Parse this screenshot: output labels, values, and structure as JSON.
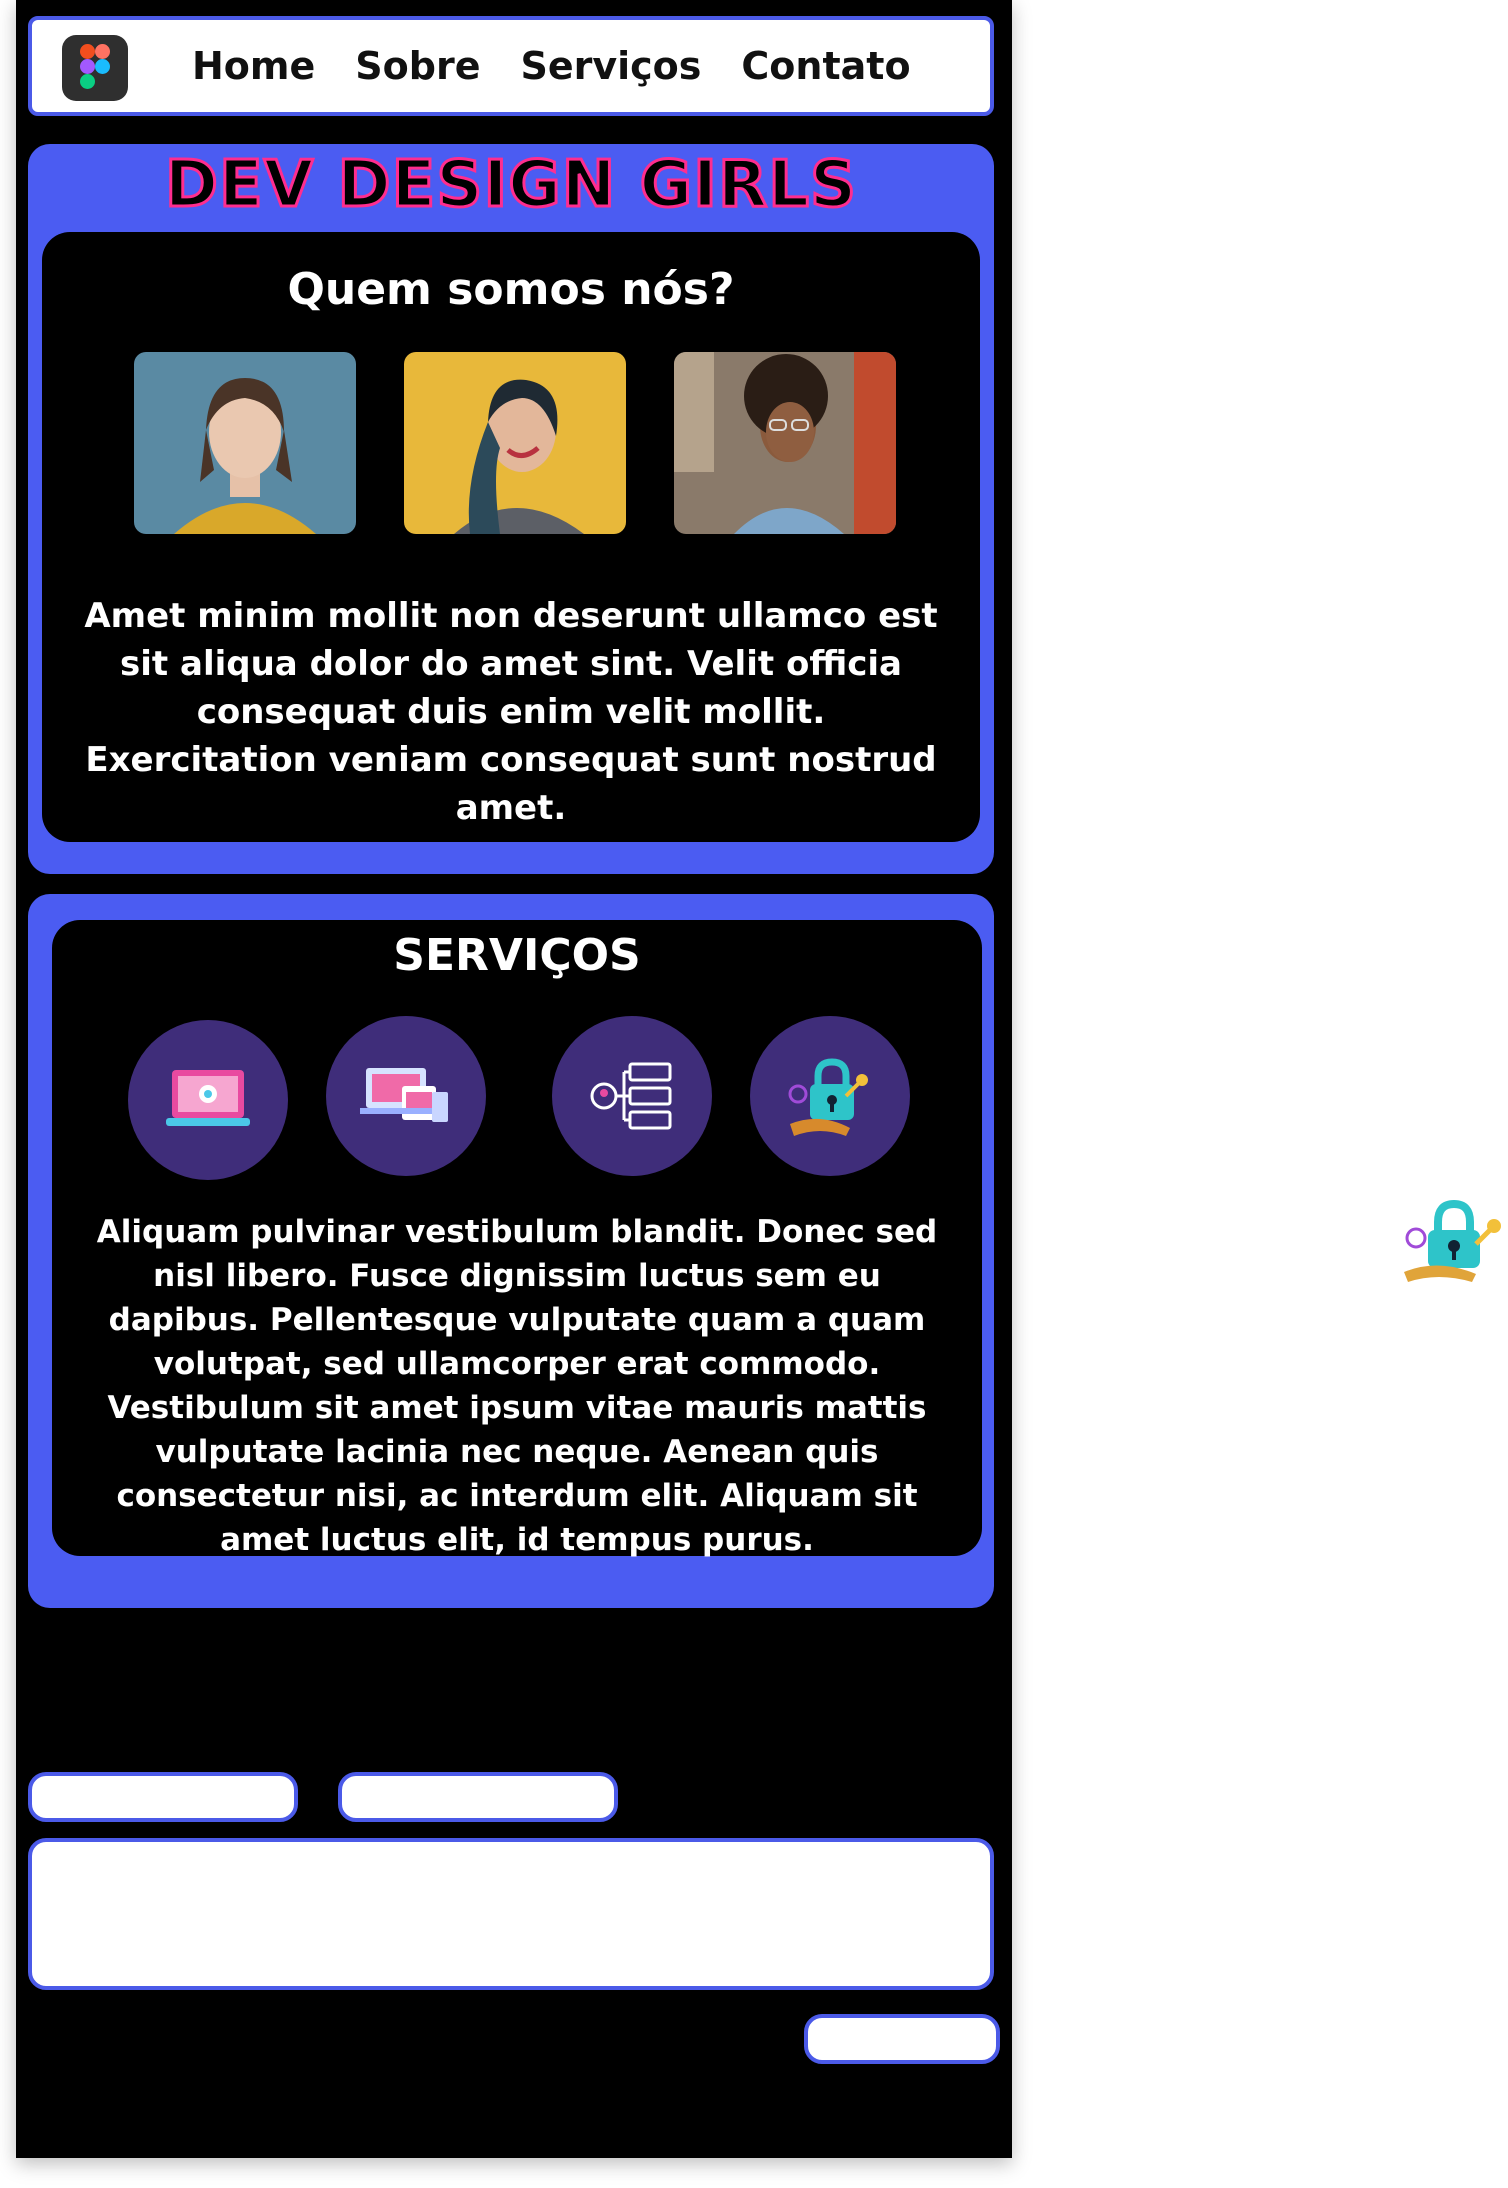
{
  "nav": {
    "logo_icon": "figma-logo-icon",
    "links": [
      "Home",
      "Sobre",
      "Serviços",
      "Contato"
    ]
  },
  "brand": "DEV DESIGN GIRLS",
  "about": {
    "title": "Quem somos nós?",
    "text": "Amet minim mollit non deserunt ullamco est sit aliqua dolor do amet sint. Velit officia consequat duis enim velit mollit. Exercitation veniam consequat sunt nostrud amet."
  },
  "services": {
    "title": "SERVIÇOS",
    "icons": [
      "ui-design-laptop-icon",
      "responsive-devices-icon",
      "user-flow-list-icon",
      "security-lock-icon"
    ],
    "text": "Aliquam pulvinar vestibulum blandit. Donec sed nisl libero. Fusce dignissim luctus sem eu dapibus. Pellentesque vulputate quam a quam volutpat, sed ullamcorper erat commodo. Vestibulum sit amet ipsum vitae mauris mattis vulputate lacinia nec neque. Aenean quis consectetur nisi, ac interdum elit. Aliquam sit amet luctus elit, id tempus purus."
  },
  "colors": {
    "accent": "#4b5cf2",
    "brand_stroke": "#ff2d8f",
    "icon_circle": "#3f2d7a",
    "background": "#000000"
  }
}
